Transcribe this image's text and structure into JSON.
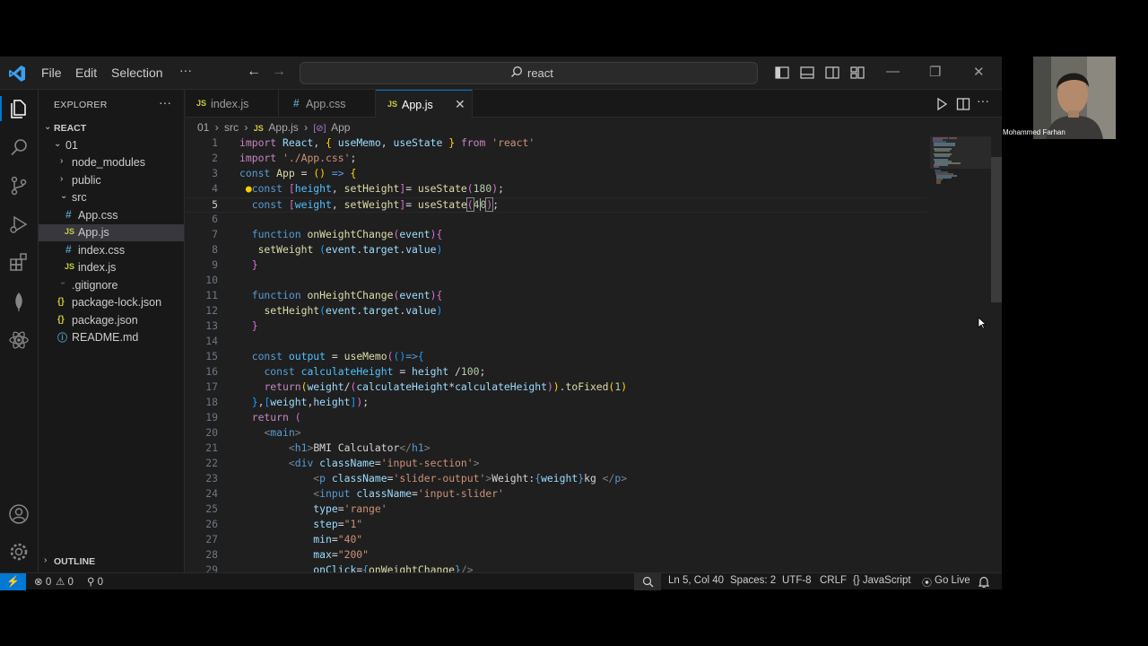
{
  "titlebar": {
    "menus": [
      "File",
      "Edit",
      "Selection"
    ],
    "more": "···",
    "search": "react"
  },
  "sidebar": {
    "title": "EXPLORER",
    "more": "···",
    "root": "REACT",
    "outline": "OUTLINE",
    "items": [
      {
        "label": "01",
        "type": "folder-open",
        "icon": "chevron-down-icon"
      },
      {
        "label": "node_modules",
        "type": "folder",
        "icon": "chevron-right-icon"
      },
      {
        "label": "public",
        "type": "folder",
        "icon": "chevron-right-icon"
      },
      {
        "label": "src",
        "type": "folder-open",
        "icon": "chevron-down-icon"
      },
      {
        "label": "App.css",
        "type": "css",
        "icon": "css-file-icon",
        "glyph": "#"
      },
      {
        "label": "App.js",
        "type": "js",
        "icon": "js-file-icon",
        "glyph": "JS",
        "selected": true
      },
      {
        "label": "index.css",
        "type": "css",
        "icon": "css-file-icon",
        "glyph": "#"
      },
      {
        "label": "index.js",
        "type": "js",
        "icon": "js-file-icon",
        "glyph": "JS"
      },
      {
        "label": ".gitignore",
        "type": "git",
        "icon": "git-file-icon",
        "glyph": "⁃"
      },
      {
        "label": "package-lock.json",
        "type": "json",
        "icon": "json-file-icon",
        "glyph": "{}"
      },
      {
        "label": "package.json",
        "type": "json",
        "icon": "json-file-icon",
        "glyph": "{}"
      },
      {
        "label": "README.md",
        "type": "md",
        "icon": "info-file-icon",
        "glyph": "ⓘ"
      }
    ]
  },
  "tabs": [
    {
      "label": "index.js",
      "glyph": "JS",
      "active": false
    },
    {
      "label": "App.css",
      "glyph": "#",
      "active": false
    },
    {
      "label": "App.js",
      "glyph": "JS",
      "active": true,
      "close": "✕"
    }
  ],
  "breadcrumb": {
    "parts": [
      "01",
      "›",
      "src",
      "›",
      "JS",
      "App.js",
      "›",
      "[⊘]",
      "App"
    ]
  },
  "editor": {
    "current_line": 5,
    "line_numbers": [
      "1",
      "2",
      "3",
      "4",
      "5",
      "6",
      "7",
      "8",
      "9",
      "10",
      "11",
      "12",
      "13",
      "14",
      "15",
      "16",
      "17",
      "18",
      "19",
      "20",
      "21",
      "22",
      "23",
      "24",
      "25",
      "26",
      "27",
      "28",
      "29"
    ]
  },
  "statusbar": {
    "remote": "⚡",
    "errors": "⊗ 0",
    "warnings": "⚠ 0",
    "ports": "⚲ 0",
    "position": "Ln 5, Col 40",
    "spaces": "Spaces: 2",
    "encoding": "UTF-8",
    "eol": "CRLF",
    "language": "{} JavaScript",
    "golive": "Go Live"
  },
  "webcam": {
    "name": "Mohammed Farhan"
  },
  "colors": {
    "accent": "#0078d4",
    "editor_bg": "#1f1f1f",
    "sidebar_bg": "#181818"
  }
}
